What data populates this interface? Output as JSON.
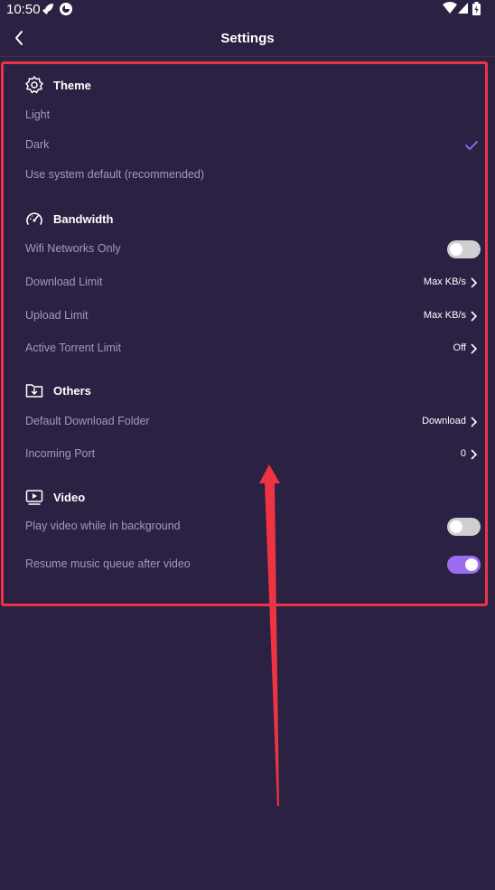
{
  "status_bar": {
    "time": "10:50"
  },
  "header": {
    "title": "Settings"
  },
  "sections": {
    "theme": {
      "title": "Theme",
      "options": [
        "Light",
        "Dark",
        "Use system default (recommended)"
      ],
      "selected": "Dark"
    },
    "bandwidth": {
      "title": "Bandwidth",
      "wifi_only": {
        "label": "Wifi Networks Only",
        "enabled": false
      },
      "download_limit": {
        "label": "Download Limit",
        "value": "Max KB/s"
      },
      "upload_limit": {
        "label": "Upload Limit",
        "value": "Max KB/s"
      },
      "active_torrent_limit": {
        "label": "Active Torrent Limit",
        "value": "Off"
      }
    },
    "others": {
      "title": "Others",
      "download_folder": {
        "label": "Default Download Folder",
        "value": "Download"
      },
      "incoming_port": {
        "label": "Incoming Port",
        "value": "0"
      }
    },
    "video": {
      "title": "Video",
      "play_background": {
        "label": "Play video while in background",
        "enabled": false
      },
      "resume_music": {
        "label": "Resume music queue after video",
        "enabled": true
      }
    }
  },
  "colors": {
    "background": "#2b2142",
    "accent": "#9a6cf0",
    "highlight_border": "#ee3342",
    "label": "#a39ab8"
  }
}
